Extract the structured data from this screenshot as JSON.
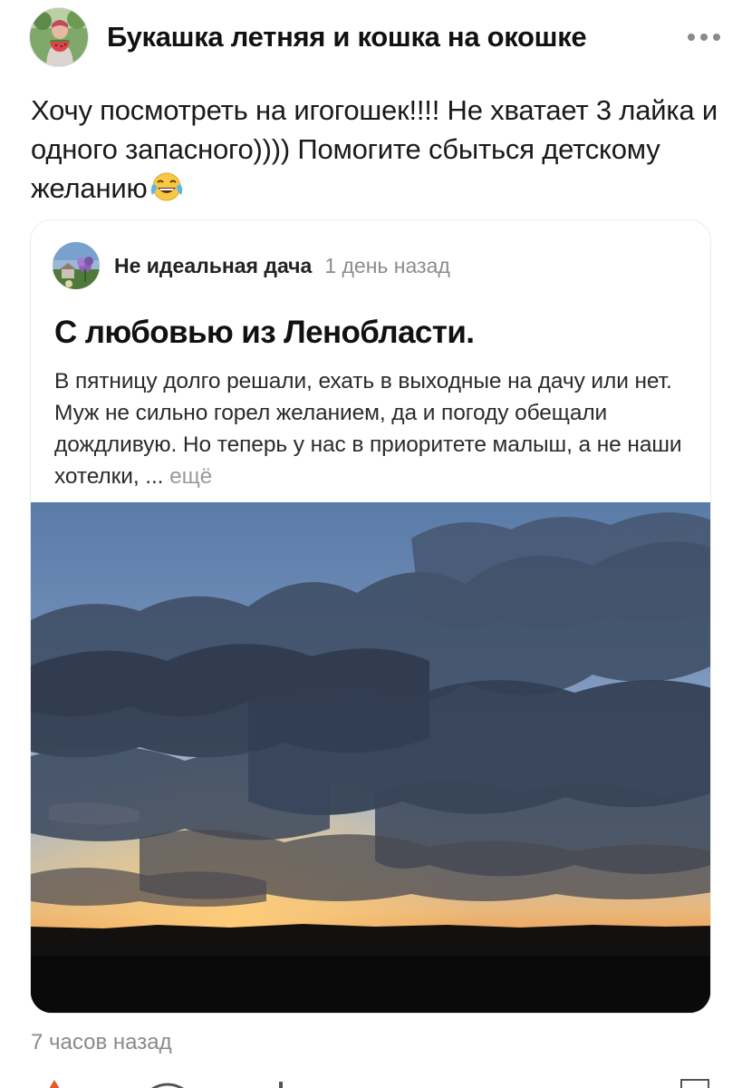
{
  "post": {
    "author": "Букашка летняя и кошка на окошке",
    "text_before_emoji": "Хочу посмотреть на игогошек!!!! Не хватает 3 лайка и одного запасного)))) Помогите сбыться детскому желанию",
    "emoji": "face-with-tears-of-joy",
    "timestamp": "7 часов назад"
  },
  "embed": {
    "source_name": "Не идеальная дача",
    "source_time": "1 день назад",
    "title": "С любовью из Ленобласти.",
    "excerpt": "В пятницу долго решали, ехать в выходные на дачу или нет. Муж не сильно горел желанием, да и погоду обещали дождливую. Но теперь у нас в приоритете малыш, а не наши хотелки, ...",
    "more_label": "ещё",
    "image": "sunset-sky-clouds-photo"
  },
  "colors": {
    "text": "#111111",
    "muted": "#8a8a8a",
    "card_border": "#ececec"
  },
  "icons": [
    "more-options-icon",
    "face-with-tears-of-joy-icon"
  ]
}
